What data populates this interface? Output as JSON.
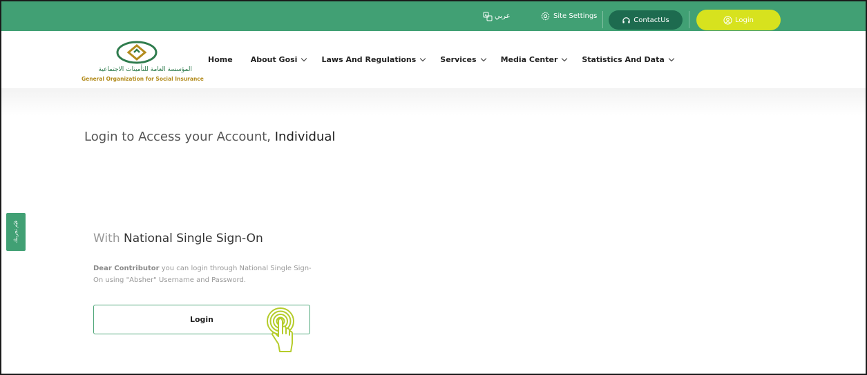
{
  "topbar": {
    "lang_label": "عربي",
    "settings_label": "Site Settings",
    "contact_label": "ContactUs",
    "login_label": "Login"
  },
  "logo": {
    "arabic_text": "المؤسسة العامة للتأمينات الاجتماعية",
    "english_text": "General Organization for Social Insurance"
  },
  "nav": {
    "items": [
      {
        "label": "Home"
      },
      {
        "label": "About Gosi"
      },
      {
        "label": "Laws And Regulations"
      },
      {
        "label": "Services"
      },
      {
        "label": "Media Center"
      },
      {
        "label": "Statistics And Data"
      }
    ]
  },
  "main": {
    "title_prefix": "Login to Access your Account,",
    "title_emphasis": "Individual",
    "side_tab_label": "قيّم تجربتك",
    "sso_prefix": "With",
    "sso_title": "National Single Sign-On",
    "desc_bold": "Dear Contributor",
    "desc_text": " you can login through National Single Sign-On using \"Absher\" Username and Password.",
    "login_button": "Login"
  },
  "colors": {
    "topbar_green": "#41a074",
    "contact_dark_green": "#1d6b4f",
    "login_yellow": "#d7e21e",
    "logo_gold": "#b38c1e"
  }
}
